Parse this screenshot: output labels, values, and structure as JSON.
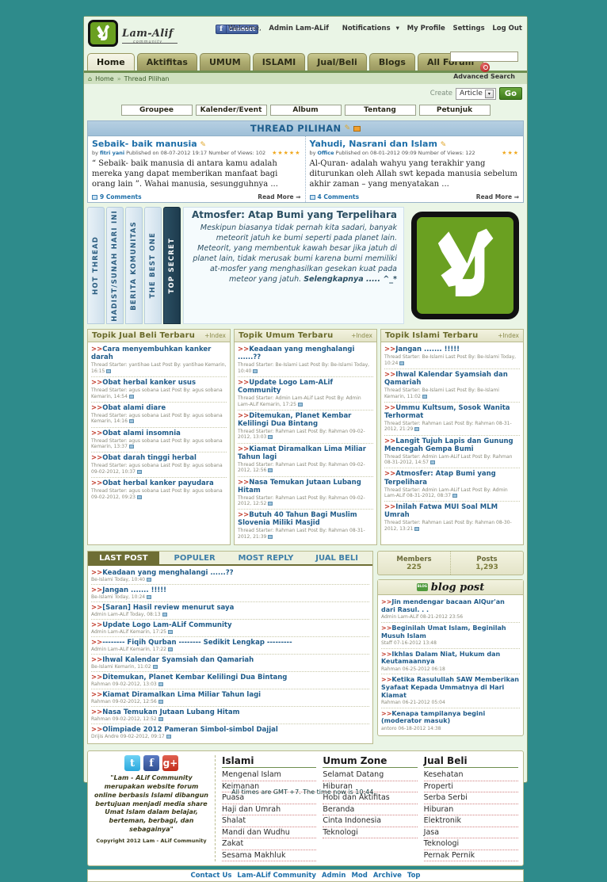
{
  "header": {
    "logo_word": "Lam-Alif",
    "logo_sub": "community",
    "fb_connect": "Connect",
    "fb_f": "f",
    "welcome": "Welcome,",
    "username": "Admin Lam-ALif",
    "notifications": "Notifications",
    "notifications_caret": "▾",
    "my_profile": "My Profile",
    "settings": "Settings",
    "logout": "Log Out"
  },
  "nav": {
    "items": [
      {
        "label": "Home",
        "active": true
      },
      {
        "label": "Aktifitas",
        "active": false
      },
      {
        "label": "UMUM",
        "active": false
      },
      {
        "label": "ISLAMI",
        "active": false
      },
      {
        "label": "Jual/Beli",
        "active": false
      },
      {
        "label": "Blogs",
        "active": false
      },
      {
        "label": "All Forum",
        "active": false
      }
    ],
    "search_value": "",
    "search_placeholder": "",
    "advanced_search": "Advanced Search"
  },
  "breadcrumb": {
    "home_icon": "⌂",
    "home": "Home",
    "sep": "»",
    "current": "Thread Pilihan"
  },
  "create_bar": {
    "label": "Create",
    "selected": "Article",
    "caret": "▾",
    "go": "Go"
  },
  "subnav": {
    "items": [
      "Groupee",
      "Kalender/Event",
      "Album",
      "Tentang",
      "Petunjuk"
    ]
  },
  "thread_pilihan": {
    "title": "THREAD PILIHAN",
    "pencil_icon": "✎",
    "mail_icon": "mail-icon",
    "threads": [
      {
        "title": "Sebaik- baik manusia",
        "by": "by",
        "author": "fitri yani",
        "published": "Published on 08-07-2012 19:17",
        "views": "Number of Views: 102",
        "stars": "★★★★★",
        "excerpt": "“ Sebaik- baik manusia di antara kamu adalah mereka yang dapat memberikan manfaat bagi orang lain ”. Wahai manusia, sesungguhnya ...",
        "comments": "9 Comments",
        "read_more": "Read More ⇒"
      },
      {
        "title": "Yahudi, Nasrani dan Islam",
        "by": "by",
        "author": "Office",
        "published": "Published on 08-01-2012 09:09",
        "views": "Number of Views: 122",
        "stars": "★★★",
        "excerpt": "Al-Quran- adalah wahyu yang terakhir yang diturunkan oleh Allah swt kepada manusia sebelum akhir zaman – yang menyatakan ...",
        "comments": "4 Comments",
        "read_more": "Read More ⇒"
      }
    ]
  },
  "banner": {
    "tabs": [
      {
        "label": "HOT THREAD",
        "dark": false,
        "small": false
      },
      {
        "label": "HADIST/SUNAH HARI INI",
        "dark": false,
        "small": false
      },
      {
        "label": "BERITA KOMUNITAS",
        "dark": false,
        "small": false
      },
      {
        "label": "THE BEST ONE",
        "dark": false,
        "small": false
      },
      {
        "label": "TOP SECRET",
        "dark": true,
        "small": false
      }
    ],
    "title": "Atmosfer: Atap Bumi yang Terpelihara",
    "body": "Meskipun biasanya tidak pernah kita sadari, banyak meteorit jatuh ke bumi seperti pada planet lain. Meteorit, yang membentuk kawah besar jika jatuh di planet lain, tidak merusak bumi karena bumi memiliki at-mosfer yang menghasilkan gesekan kuat pada meteor yang jatuh.",
    "more": "Selengkapnya ..... ^_*"
  },
  "topic_columns": [
    {
      "heading": "Topik Jual Beli Terbaru",
      "index": "+Index",
      "items": [
        {
          "title": "Cara menyembuhkan kanker darah",
          "meta": "Thread Starter: yantihae Last Post By: yantihae Kemarin, 16:15"
        },
        {
          "title": "Obat herbal kanker usus",
          "meta": "Thread Starter: agus sobana Last Post By: agus sobana Kemarin, 14:54"
        },
        {
          "title": "Obat alami diare",
          "meta": "Thread Starter: agus sobana Last Post By: agus sobana Kemarin, 14:16"
        },
        {
          "title": "Obat alami insomnia",
          "meta": "Thread Starter: agus sobana Last Post By: agus sobana Kemarin, 13:37"
        },
        {
          "title": "Obat darah tinggi herbal",
          "meta": "Thread Starter: agus sobana Last Post By: agus sobana 09-02-2012, 10:37"
        },
        {
          "title": "Obat herbal kanker payudara",
          "meta": "Thread Starter: agus sobana Last Post By: agus sobana 09-02-2012, 09:23"
        }
      ]
    },
    {
      "heading": "Topik Umum Terbaru",
      "index": "+Index",
      "items": [
        {
          "title": "Keadaan yang menghalangi ......??",
          "meta": "Thread Starter: Be-Islami Last Post By: Be-Islami Today, 10:40"
        },
        {
          "title": "Update Logo Lam-ALif Community",
          "meta": "Thread Starter: Admin Lam-ALif Last Post By: Admin Lam-ALif Kemarin, 17:25"
        },
        {
          "title": "Ditemukan, Planet Kembar Kelilingi Dua Bintang",
          "meta": "Thread Starter: Rahman Last Post By: Rahman 09-02-2012, 13:03"
        },
        {
          "title": "Kiamat Diramalkan Lima Miliar Tahun lagi",
          "meta": "Thread Starter: Rahman Last Post By: Rahman 09-02-2012, 12:56"
        },
        {
          "title": "Nasa Temukan Jutaan Lubang Hitam",
          "meta": "Thread Starter: Rahman Last Post By: Rahman 09-02-2012, 12:52"
        },
        {
          "title": "Butuh 40 Tahun Bagi Muslim Slovenia Miliki Masjid",
          "meta": "Thread Starter: Rahman Last Post By: Rahman 08-31-2012, 21:39"
        }
      ]
    },
    {
      "heading": "Topik Islami Terbaru",
      "index": "+Index",
      "items": [
        {
          "title": "Jangan ....... !!!!!",
          "meta": "Thread Starter: Be-Islami Last Post By: Be-Islami Today, 10:24"
        },
        {
          "title": "Ihwal Kalendar Syamsiah dan Qamariah",
          "meta": "Thread Starter: Be-Islami Last Post By: Be-Islami Kemarin, 11:02"
        },
        {
          "title": "Ummu Kultsum, Sosok Wanita Terhormat",
          "meta": "Thread Starter: Rahman Last Post By: Rahman 08-31-2012, 21:29"
        },
        {
          "title": "Langit Tujuh Lapis dan Gunung Mencegah Gempa Bumi",
          "meta": "Thread Starter: Admin Lam-ALif Last Post By: Rahman 08-31-2012, 14:57"
        },
        {
          "title": "Atmosfer: Atap Bumi yang Terpelihara",
          "meta": "Thread Starter: Admin Lam-ALif Last Post By: Admin Lam-ALif 08-31-2012, 08:37"
        },
        {
          "title": "Inilah Fatwa MUI Soal MLM Umrah",
          "meta": "Thread Starter: Rahman Last Post By: Rahman 08-30-2012, 13:21"
        }
      ]
    }
  ],
  "last_post": {
    "tabs": [
      {
        "label": "LAST POST",
        "active": true
      },
      {
        "label": "POPULER",
        "active": false
      },
      {
        "label": "MOST REPLY",
        "active": false
      },
      {
        "label": "JUAL BELI",
        "active": false
      }
    ],
    "items": [
      {
        "title": "Keadaan yang menghalangi ......??",
        "meta": "Be-Islami Today, 10:40"
      },
      {
        "title": "Jangan ....... !!!!!",
        "meta": "Be-Islami Today, 10:24"
      },
      {
        "title": "[Saran] Hasil review menurut saya",
        "meta": "Admin Lam-ALif Today, 08:13"
      },
      {
        "title": "Update Logo Lam-ALif Community",
        "meta": "Admin Lam-ALif Kemarin, 17:25"
      },
      {
        "title": "-------- Fiqih Qurban -------- Sedikit Lengkap ---------",
        "meta": "Admin Lam-ALif Kemarin, 17:22"
      },
      {
        "title": "Ihwal Kalendar Syamsiah dan Qamariah",
        "meta": "Be-Islami Kemarin, 11:02"
      },
      {
        "title": "Ditemukan, Planet Kembar Kelilingi Dua Bintang",
        "meta": "Rahman 09-02-2012, 13:03"
      },
      {
        "title": "Kiamat Diramalkan Lima Miliar Tahun lagi",
        "meta": "Rahman 09-02-2012, 12:56"
      },
      {
        "title": "Nasa Temukan Jutaan Lubang Hitam",
        "meta": "Rahman 09-02-2012, 12:52"
      },
      {
        "title": "Olimpiade 2012 Pameran Simbol-simbol Dajjal",
        "meta": "Drijis Andre 09-02-2012, 09:17"
      }
    ]
  },
  "stats": {
    "members_label": "Members",
    "members_value": "225",
    "posts_label": "Posts",
    "posts_value": "1,293"
  },
  "blog": {
    "title": "blog post",
    "icon": "blog-icon",
    "items": [
      {
        "title": "Jin mendengar bacaan AlQur'an dari Rasul. . .",
        "meta": "Admin Lam-ALif 08-21-2012 23:56"
      },
      {
        "title": "Beginilah Umat Islam, Beginilah Musuh Islam",
        "meta": "Staff 07-16-2012 13:48"
      },
      {
        "title": "Ikhlas Dalam Niat, Hukum dan Keutamaannya",
        "meta": "Rahman 06-25-2012 06:18"
      },
      {
        "title": "Ketika Rasulullah SAW Memberikan Syafaat Kepada Ummatnya di Hari Kiamat",
        "meta": "Rahman 06-21-2012 05:04"
      },
      {
        "title": "Kenapa tampilanya begini (moderator masuk)",
        "meta": "antoro 06-18-2012 14:38"
      }
    ]
  },
  "footer": {
    "socials": [
      {
        "name": "twitter-icon",
        "glyph": "t"
      },
      {
        "name": "facebook-icon",
        "glyph": "f"
      },
      {
        "name": "google-plus-icon",
        "glyph": "g+"
      }
    ],
    "about": "\"Lam - ALif Community merupakan website forum online berbasis Islami dibangun bertujuan menjadi media share Umat Islam dalam belajar, berteman, berbagi, dan sebagainya\"",
    "copyright": "Copyright 2012 Lam - ALif Community",
    "columns": [
      {
        "heading": "Islami",
        "links": [
          "Mengenal Islam",
          "Keimanan",
          "Puasa",
          "Haji dan Umrah",
          "Shalat",
          "Mandi dan Wudhu",
          "Zakat",
          "Sesama Makhluk"
        ]
      },
      {
        "heading": "Umum Zone",
        "links": [
          "Selamat Datang",
          "Hiburan",
          "Hobi dan Aktifitas",
          "Beranda",
          "Cinta Indonesia",
          "Teknologi"
        ]
      },
      {
        "heading": "Jual Beli",
        "links": [
          "Kesehatan",
          "Properti",
          "Serba Serbi",
          "Hiburan",
          "Elektronik",
          "Jasa",
          "Teknologi",
          "Pernak Pernik"
        ]
      }
    ],
    "bottom_links": [
      "Contact Us",
      "Lam-ALif Community",
      "Admin",
      "Mod",
      "Archive",
      "Top"
    ],
    "gmt": "All times are GMT +7. The time now is 10:44."
  },
  "colors": {
    "page_bg": "#2e8b8b",
    "forum_bg": "#eaf5e6",
    "nav_olive": "#a8a768",
    "link_blue": "#205c8a",
    "arrow_red": "#c23b2b",
    "logo_green": "#6aa021",
    "tab_dark": "#2b4f63"
  }
}
